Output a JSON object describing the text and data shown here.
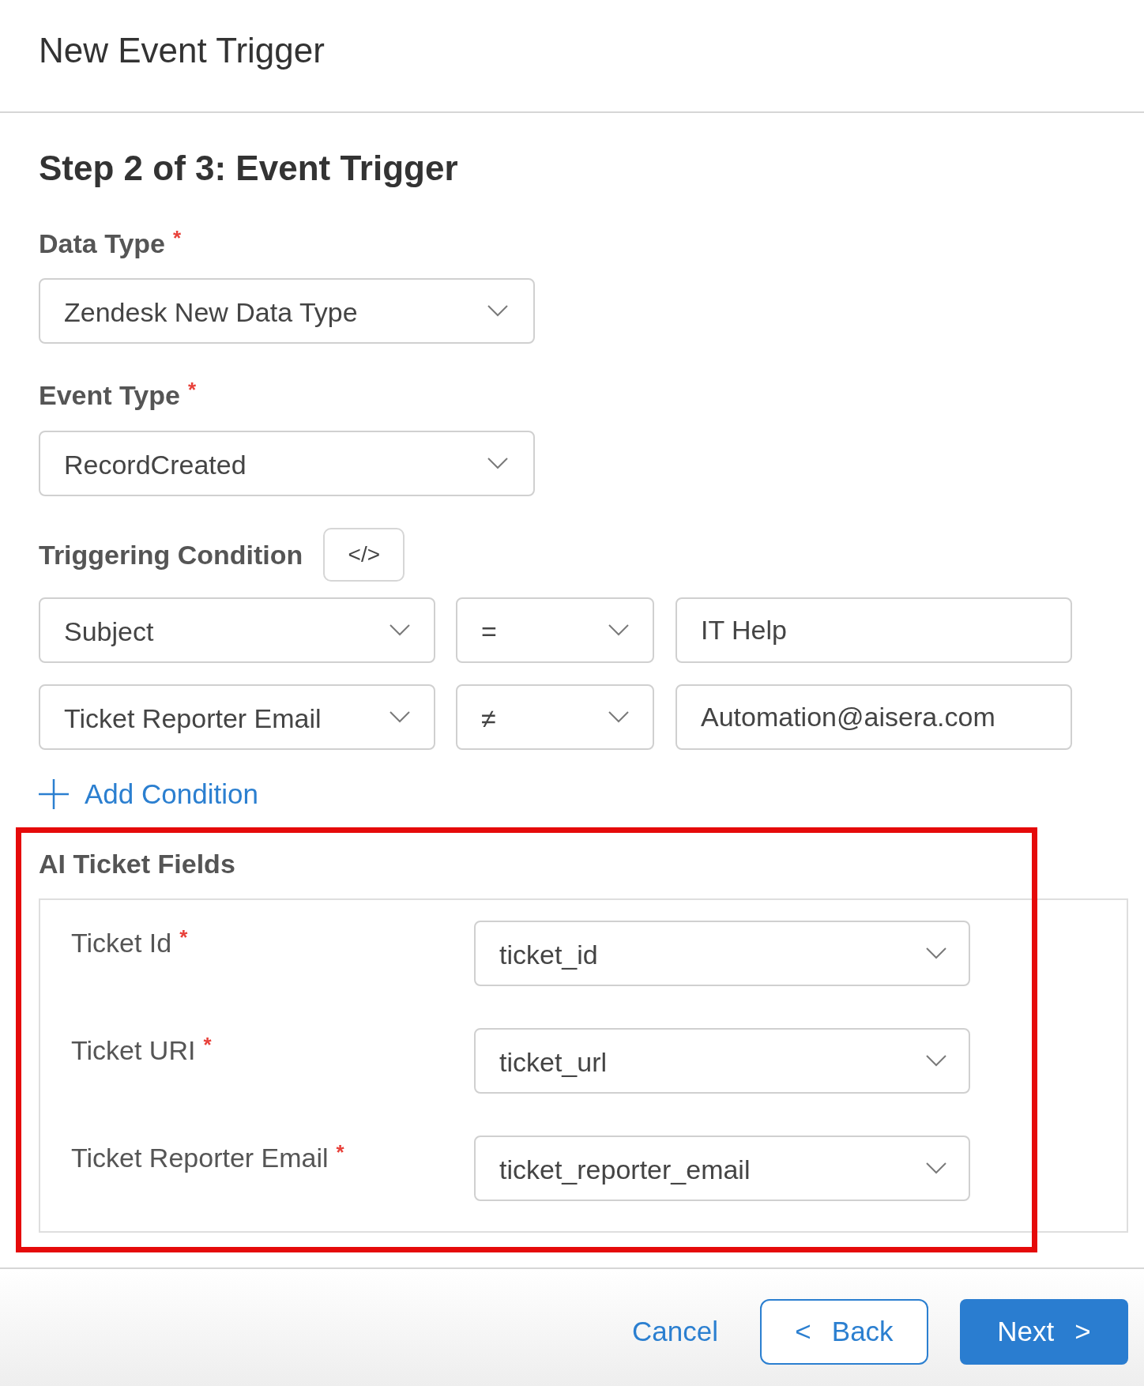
{
  "dialog": {
    "title": "New Event Trigger"
  },
  "step": {
    "title": "Step 2 of 3: Event Trigger"
  },
  "data_type": {
    "label": "Data Type",
    "required_mark": "*",
    "value": "Zendesk New Data Type"
  },
  "event_type": {
    "label": "Event Type",
    "required_mark": "*",
    "value": "RecordCreated"
  },
  "triggering_condition": {
    "label": "Triggering Condition",
    "code_button": "</>",
    "conditions": [
      {
        "field": "Subject",
        "operator": "=",
        "value": "IT Help"
      },
      {
        "field": "Ticket Reporter Email",
        "operator": "≠",
        "value": "Automation@aisera.com"
      }
    ],
    "add_button": "Add Condition"
  },
  "ai_ticket_fields": {
    "title": "AI Ticket Fields",
    "highlighted": true,
    "fields": [
      {
        "label": "Ticket Id",
        "required_mark": "*",
        "value": "ticket_id"
      },
      {
        "label": "Ticket URI",
        "required_mark": "*",
        "value": "ticket_url"
      },
      {
        "label": "Ticket Reporter Email",
        "required_mark": "*",
        "value": "ticket_reporter_email"
      }
    ]
  },
  "footer": {
    "buttons": [
      {
        "kind": "link",
        "label": "Cancel"
      },
      {
        "kind": "outline",
        "label": "Back",
        "glyph_before": "<"
      },
      {
        "kind": "primary",
        "label": "Next",
        "glyph_after": ">"
      }
    ]
  }
}
